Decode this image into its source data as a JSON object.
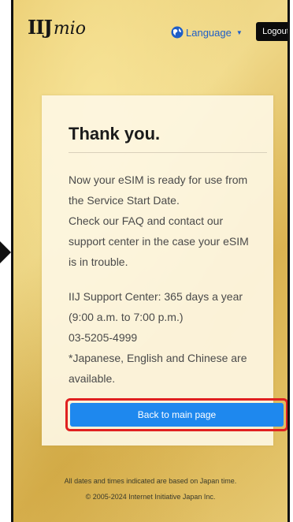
{
  "header": {
    "logo_text_main": "IIJ",
    "logo_text_script": "mio",
    "language_label": "Language",
    "logout_label": "Logout"
  },
  "content": {
    "title": "Thank you.",
    "paragraph1": "Now your eSIM is ready for use from\nthe Service Start Date.\nCheck our FAQ and contact our\nsupport center in the case your eSIM\nis in trouble.",
    "paragraph2": "IIJ Support Center: 365 days a year\n(9:00 a.m. to 7:00 p.m.)\n03-5205-4999\n*Japanese, English and Chinese are\navailable.",
    "button_label": "Back to main page"
  },
  "footer": {
    "note": "All dates and times indicated are based on Japan time.",
    "copyright": "© 2005-2024 Internet Initiative Japan Inc."
  },
  "colors": {
    "accent_blue": "#1e88ee",
    "highlight_red": "#e02020",
    "logout_bg": "#0b0b0b",
    "language_blue": "#1e5ec8"
  },
  "icons": {
    "arrow": "arrow-right-icon",
    "globe": "globe-icon",
    "caret": "caret-down-icon"
  }
}
